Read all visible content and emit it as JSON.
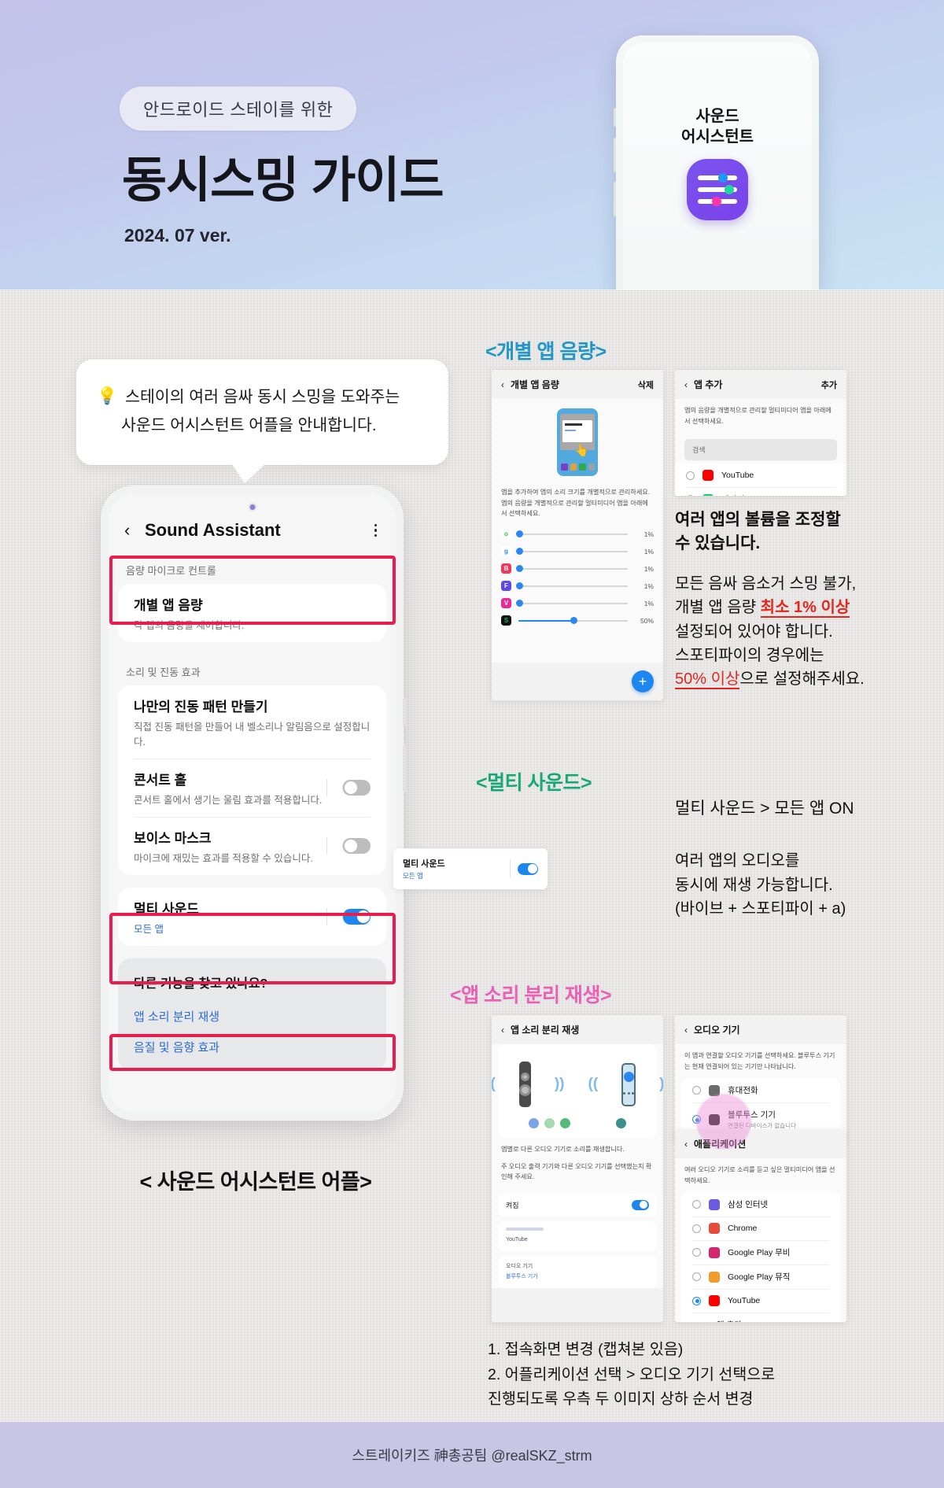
{
  "header": {
    "pill": "안드로이드 스테이를 위한",
    "title": "동시스밍 가이드",
    "version": "2024. 07 ver.",
    "hero_app_name": "사운드\n어시스턴트"
  },
  "bubble": {
    "icon": "💡",
    "line1": "스테이의 여러 음싸 동시 스밍을 도와주는",
    "line2": "사운드 어시스턴트 어플을 안내합니다."
  },
  "main_phone": {
    "appbar": {
      "back": "‹",
      "title": "Sound Assistant",
      "menu": "more-menu"
    },
    "section1_label": "음량 마이크로 컨트롤",
    "row_individual": {
      "title": "개별 앱 음량",
      "sub": "각 앱의 음량을 제어합니다."
    },
    "section2_label": "소리 및 진동 효과",
    "row_vibration": {
      "title": "나만의 진동 패턴 만들기",
      "sub": "직접 진동 패턴을 만들어 내 벨소리나 알림음으로 설정합니다."
    },
    "row_concert": {
      "title": "콘서트 홀",
      "sub": "콘서트 홀에서 생기는 울림 효과를 적용합니다.",
      "toggle": "off"
    },
    "row_voicemask": {
      "title": "보이스 마스크",
      "sub": "마이크에 재밌는 효과를 적용할 수 있습니다.",
      "toggle": "off"
    },
    "row_multisound": {
      "title": "멀티 사운드",
      "sub": "모든 앱",
      "toggle": "on"
    },
    "other_question": "다른 기능을 찾고 있나요?",
    "link1": "앱 소리 분리 재생",
    "link2": "음질 및 음향 효과",
    "caption": "< 사운드 어시스턴트 어플>"
  },
  "section_individual": {
    "heading": "<개별 앱 음량>",
    "shot": {
      "title": "개별 앱 음량",
      "action": "삭제",
      "desc": "앱을 추가하여 앱의 소리 크기를 개별적으로 관리하세요. 앱의 음량을 개별적으로 관리할 멀티미디어 앱을 아래에서 선택하세요.",
      "sliders": [
        {
          "app": "xbox-icon",
          "color": "#ffffff",
          "glyph": "o",
          "text_color": "#2ecc40",
          "value": 1,
          "label": "1%"
        },
        {
          "app": "google-icon",
          "color": "#ffffff",
          "glyph": "g",
          "text_color": "#2b87ef",
          "value": 1,
          "label": "1%"
        },
        {
          "app": "bugs-icon",
          "color": "#f5365c",
          "glyph": "B",
          "text_color": "#ffffff",
          "value": 1,
          "label": "1%"
        },
        {
          "app": "flo-icon",
          "color": "#5b4ae8",
          "glyph": "F",
          "text_color": "#ffffff",
          "value": 1,
          "label": "1%"
        },
        {
          "app": "vibe-icon",
          "color": "#e8299a",
          "glyph": "V",
          "text_color": "#ffffff",
          "value": 1,
          "label": "1%"
        },
        {
          "app": "spotify-icon",
          "color": "#111111",
          "glyph": "S",
          "text_color": "#1db954",
          "value": 50,
          "label": "50%"
        }
      ],
      "fab": "+"
    },
    "add_shot": {
      "title": "앱 추가",
      "action": "추가",
      "desc": "앱의 음량을 개별적으로 관리할 멀티미디어 앱을 아래에서 선택하세요.",
      "search_placeholder": "검색",
      "apps": [
        {
          "name": "YouTube",
          "icon": "youtube-icon",
          "selected": false
        },
        {
          "name": "네이버TV",
          "icon": "navertv-icon",
          "selected": false
        }
      ]
    },
    "prose_head": "여러 앱의 볼륨을 조정할\n수 있습니다.",
    "prose_l1": "모든 음싸 음소거 스밍 불가,",
    "prose_l2_a": "개별 앱 음량 ",
    "prose_l2_red": "최소 1% 이상",
    "prose_l3": "설정되어 있어야 합니다.",
    "prose_l4": "스포티파이의 경우에는",
    "prose_l5_red": "50% 이상",
    "prose_l5_b": "으로 설정해주세요."
  },
  "section_multisound": {
    "heading": "<멀티 사운드>",
    "card": {
      "title": "멀티 사운드",
      "sub": "모든 앱",
      "toggle": "on"
    },
    "prose_head": "멀티 사운드 > 모든 앱 ON",
    "prose_l1": "여러 앱의 오디오를",
    "prose_l2": "동시에 재생 가능합니다.",
    "prose_l3": "(바이브 + 스포티파이 + a)"
  },
  "section_separate": {
    "heading": "<앱 소리 분리 재생>",
    "shot": {
      "title": "앱 소리 분리 재생",
      "desc1": "앱별로 다른 오디오 기기로 소리를 재생합니다.",
      "desc2": "주 오디오 출력 기기와 다른 오디오 기기를 선택했는지 확인해 주세요.",
      "toggle_label": "켜짐",
      "toggle": "on",
      "app_entry": "YouTube",
      "device_label": "오디오 기기",
      "device_value": "블루투스 기기"
    },
    "audio_device_shot": {
      "title": "오디오 기기",
      "desc": "이 앱과 연결할 오디오 기기를 선택하세요. 블루투스 기기는 현재 연결되어 있는 기기만 나타납니다.",
      "options": [
        {
          "name": "휴대전화",
          "icon": "phone-icon",
          "sub": "",
          "selected": false
        },
        {
          "name": "블루투스 기기",
          "icon": "bluetooth-icon",
          "sub": "연결된 디바이스가 없습니다",
          "selected": true
        }
      ]
    },
    "application_shot": {
      "title": "애플리케이션",
      "desc": "여러 오디오 기기로 소리를 듣고 싶은 멀티미디어 앱을 선택하세요.",
      "apps": [
        {
          "name": "삼성 인터넷",
          "icon": "samsung-internet-icon",
          "selected": false
        },
        {
          "name": "Chrome",
          "icon": "chrome-icon",
          "selected": false
        },
        {
          "name": "Google Play 무비",
          "icon": "google-play-movies-icon",
          "selected": false
        },
        {
          "name": "Google Play 뮤직",
          "icon": "google-play-music-icon",
          "selected": false
        },
        {
          "name": "YouTube",
          "icon": "youtube-icon",
          "selected": true
        }
      ],
      "add_app": "앱 추가",
      "add_icon": "plus-icon"
    },
    "step1": "1. 접속화면 변경 (캡쳐본 있음)",
    "step2": "2. 어플리케이션 선택 > 오디오 기기 선택으로",
    "step3": "진행되도록 우측 두 이미지 상하 순서 변경"
  },
  "footer": {
    "credit": "스트레이키즈 神총공팀 @realSKZ_strm"
  },
  "colors": {
    "highlight_red": "#ea1b4d",
    "accent_blue": "#1d87f0",
    "heading_blue": "#2196c8",
    "heading_green": "#17a878",
    "heading_pink": "#ec5fb4",
    "warn_red": "#e8241c",
    "app_purple": "#7b53ee"
  }
}
